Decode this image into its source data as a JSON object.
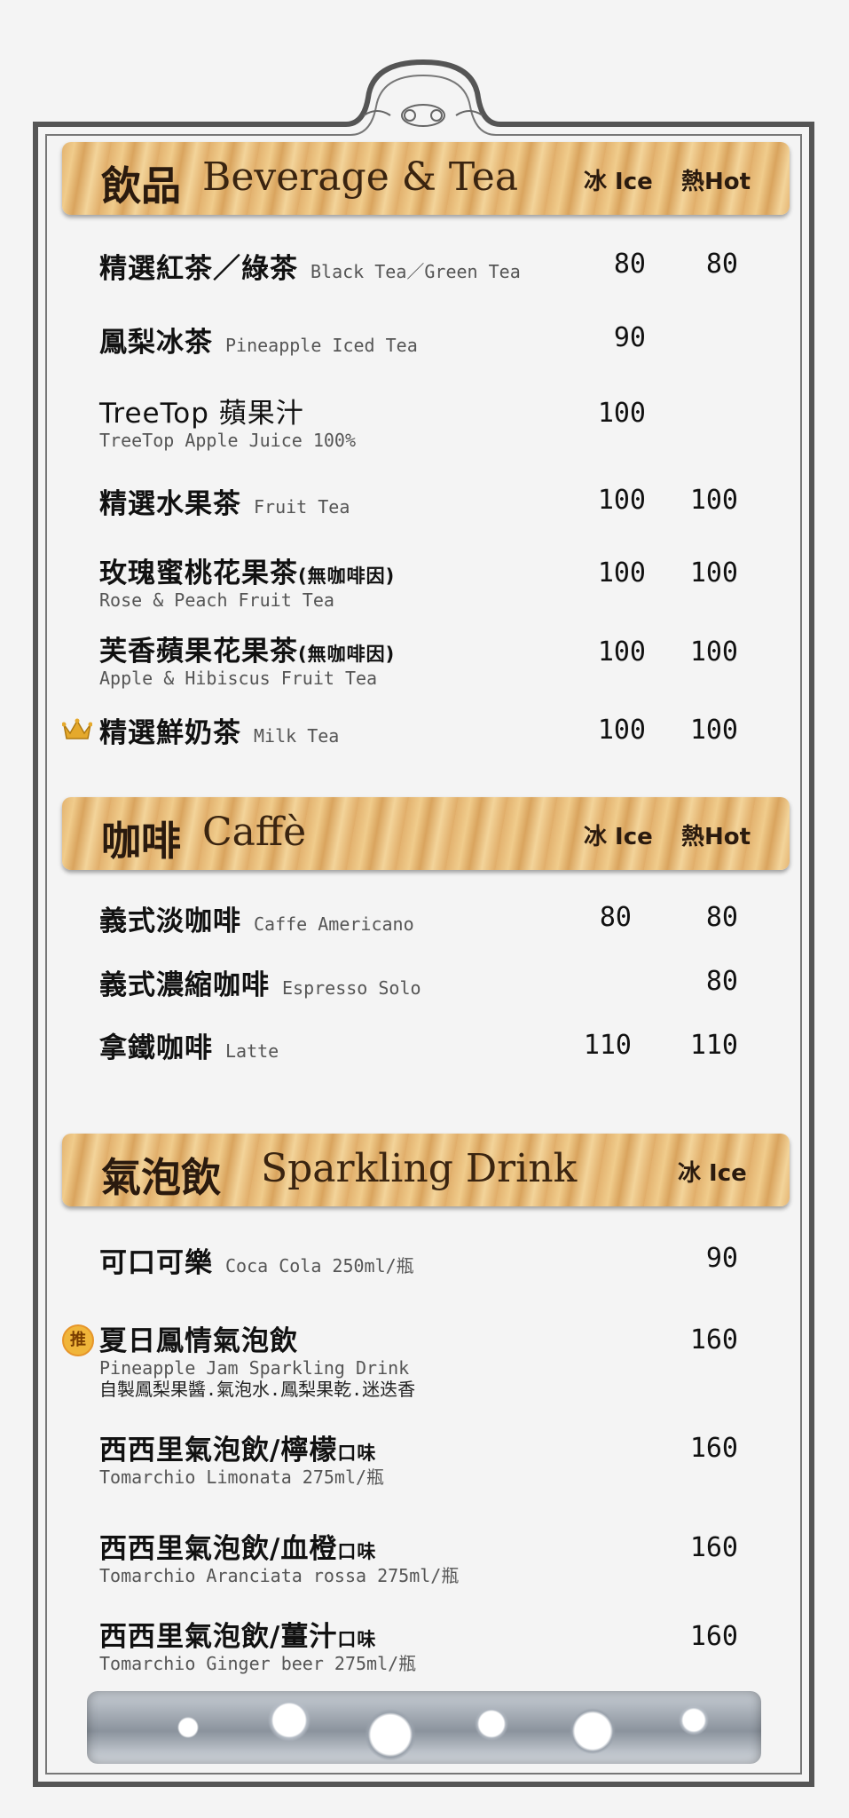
{
  "sections": [
    {
      "title_cjk": "飲品",
      "title_en": "Beverage & Tea",
      "col_ice": "冰 Ice",
      "col_hot": "熱Hot",
      "items": [
        {
          "zh": "精選紅茶／綠茶",
          "en": "Black Tea／Green Tea",
          "ice": "80",
          "hot": "80"
        },
        {
          "zh": "鳳梨冰茶",
          "en": "Pineapple Iced Tea",
          "ice": "90",
          "hot": ""
        },
        {
          "zh": "TreeTop 蘋果汁",
          "en": "TreeTop Apple Juice 100%",
          "ice": "100",
          "hot": ""
        },
        {
          "zh": "精選水果茶",
          "en": "Fruit Tea",
          "ice": "100",
          "hot": "100"
        },
        {
          "zh": "玫瑰蜜桃花果茶",
          "note": "(無咖啡因)",
          "en": "Rose & Peach Fruit Tea",
          "ice": "100",
          "hot": "100"
        },
        {
          "zh": "芙香蘋果花果茶",
          "note": "(無咖啡因)",
          "en": "Apple & Hibiscus Fruit Tea",
          "ice": "100",
          "hot": "100"
        },
        {
          "zh": "精選鮮奶茶",
          "en": "Milk Tea",
          "ice": "100",
          "hot": "100",
          "icon": "crown-icon"
        }
      ]
    },
    {
      "title_cjk": "咖啡",
      "title_en": "Caffè",
      "col_ice": "冰 Ice",
      "col_hot": "熱Hot",
      "items": [
        {
          "zh": "義式淡咖啡",
          "en": "Caffe Americano",
          "ice": "80",
          "hot": "80"
        },
        {
          "zh": "義式濃縮咖啡",
          "en": "Espresso Solo",
          "ice": "",
          "hot": "80"
        },
        {
          "zh": "拿鐵咖啡",
          "en": "Latte",
          "ice": "110",
          "hot": "110"
        }
      ]
    },
    {
      "title_cjk": "氣泡飲",
      "title_en": "Sparkling Drink",
      "col_ice": "冰 Ice",
      "items": [
        {
          "zh": "可口可樂",
          "en": "Coca Cola 250ml/瓶",
          "ice": "90"
        },
        {
          "zh": "夏日鳳情氣泡飲",
          "en": "Pineapple Jam Sparkling Drink",
          "desc": "自製鳳梨果醬.氣泡水.鳳梨果乾.迷迭香",
          "ice": "160",
          "badge": "推"
        },
        {
          "zh": "西西里氣泡飲/檸檬",
          "flavor": "口味",
          "en": "Tomarchio Limonata 275ml/瓶",
          "ice": "160"
        },
        {
          "zh": "西西里氣泡飲/血橙",
          "flavor": "口味",
          "en": "Tomarchio Aranciata rossa 275ml/瓶",
          "ice": "160"
        },
        {
          "zh": "西西里氣泡飲/薑汁",
          "flavor": "口味",
          "en": "Tomarchio Ginger beer 275ml/瓶",
          "ice": "160"
        }
      ]
    }
  ],
  "colors": {
    "wood": "#e3b370",
    "frame": "#555555",
    "background": "#f4f4f4"
  }
}
